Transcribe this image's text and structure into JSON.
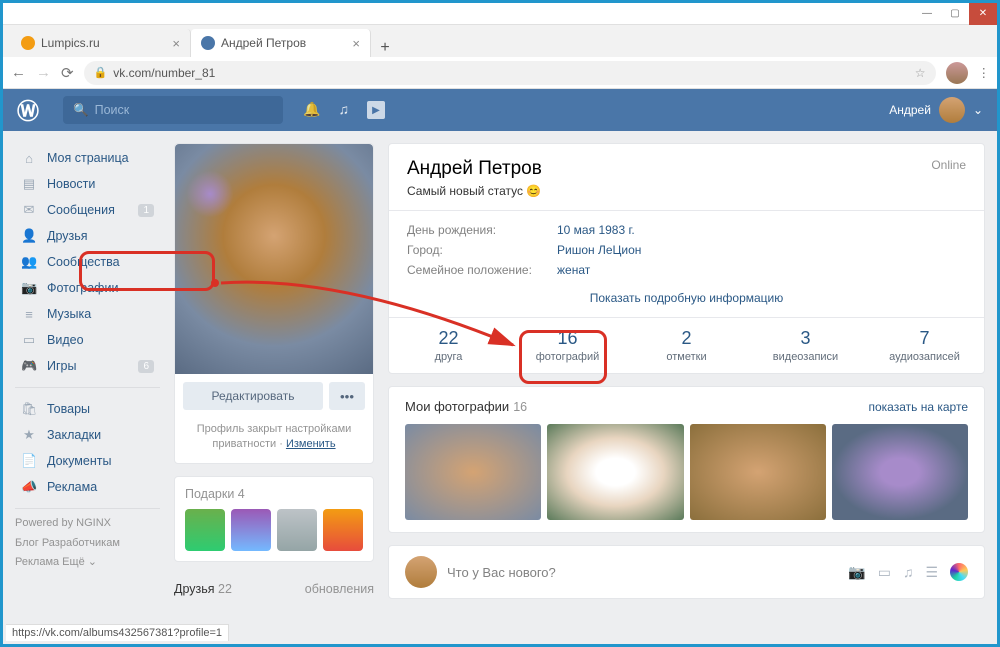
{
  "tabs": {
    "tab1": "Lumpics.ru",
    "tab2": "Андрей Петров"
  },
  "url": "vk.com/number_81",
  "vk_search_placeholder": "Поиск",
  "header_user": "Андрей",
  "sidebar": {
    "items": [
      {
        "label": "Моя страница",
        "badge": null
      },
      {
        "label": "Новости",
        "badge": null
      },
      {
        "label": "Сообщения",
        "badge": "1"
      },
      {
        "label": "Друзья",
        "badge": null
      },
      {
        "label": "Сообщества",
        "badge": null
      },
      {
        "label": "Фотографии",
        "badge": null
      },
      {
        "label": "Музыка",
        "badge": null
      },
      {
        "label": "Видео",
        "badge": null
      },
      {
        "label": "Игры",
        "badge": "6"
      },
      {
        "label": "Товары",
        "badge": null
      },
      {
        "label": "Закладки",
        "badge": null
      },
      {
        "label": "Документы",
        "badge": null
      },
      {
        "label": "Реклама",
        "badge": null
      }
    ],
    "powered": "Powered by NGINX",
    "links1": "Блог   Разработчикам",
    "links2": "Реклама   Ещё ⌄"
  },
  "profile_card": {
    "edit": "Редактировать",
    "privacy_text": "Профиль закрыт настройками приватности · ",
    "privacy_link": "Изменить"
  },
  "gifts": {
    "title": "Подарки",
    "count": "4"
  },
  "friends_block": {
    "title": "Друзья",
    "count": "22",
    "updates": "обновления"
  },
  "info": {
    "name": "Андрей Петров",
    "online": "Online",
    "status": "Самый новый статус 😊",
    "rows": [
      {
        "lbl": "День рождения:",
        "val": "10 мая 1983 г."
      },
      {
        "lbl": "Город:",
        "val": "Ришон ЛеЦион"
      },
      {
        "lbl": "Семейное положение:",
        "val": "женат"
      }
    ],
    "more": "Показать подробную информацию",
    "counters": [
      {
        "num": "22",
        "lbl": "друга"
      },
      {
        "num": "16",
        "lbl": "фотографий"
      },
      {
        "num": "2",
        "lbl": "отметки"
      },
      {
        "num": "3",
        "lbl": "видеозаписи"
      },
      {
        "num": "7",
        "lbl": "аудиозаписей"
      }
    ]
  },
  "photos": {
    "title": "Мои фотографии",
    "count": "16",
    "map_link": "показать на карте"
  },
  "post": {
    "placeholder": "Что у Вас нового?"
  },
  "status_url": "https://vk.com/albums432567381?profile=1"
}
